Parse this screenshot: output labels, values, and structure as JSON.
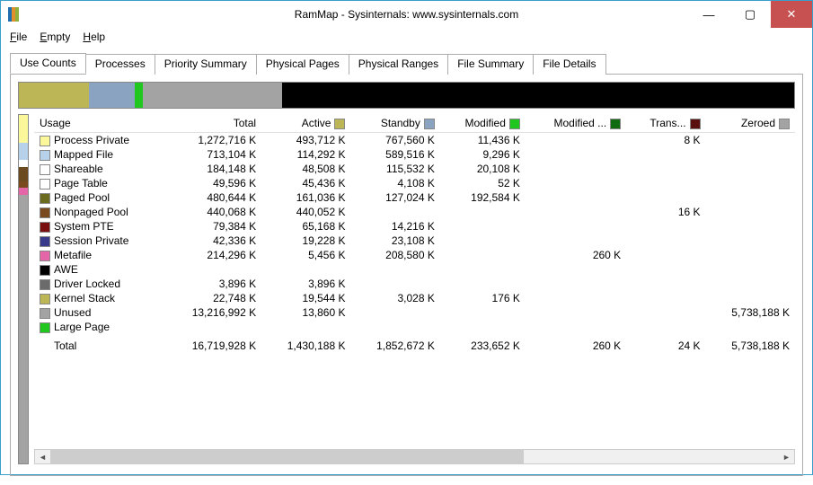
{
  "window": {
    "title": "RamMap - Sysinternals: www.sysinternals.com",
    "icon_colors": [
      "#1f6fb0",
      "#e08f2c",
      "#8fb03a"
    ]
  },
  "menubar": [
    {
      "label": "File",
      "u": "F"
    },
    {
      "label": "Empty",
      "u": "E"
    },
    {
      "label": "Help",
      "u": "H"
    }
  ],
  "tabs": [
    "Use Counts",
    "Processes",
    "Priority Summary",
    "Physical Pages",
    "Physical Ranges",
    "File Summary",
    "File Details"
  ],
  "active_tab": 0,
  "stackbar": [
    {
      "color": "#bcb656",
      "pct": 9.0
    },
    {
      "color": "#8aa3c1",
      "pct": 6.0
    },
    {
      "color": "#1fc71f",
      "pct": 1.0
    },
    {
      "color": "#a3a3a3",
      "pct": 18.0
    },
    {
      "color": "#000000",
      "pct": 66.0
    }
  ],
  "leftlegend": [
    {
      "color": "#fbf89b",
      "pct": 8
    },
    {
      "color": "#b8d1ea",
      "pct": 5
    },
    {
      "color": "#ffffff",
      "pct": 2
    },
    {
      "color": "#6b4a1f",
      "pct": 4
    },
    {
      "color": "#7a4a1f",
      "pct": 2
    },
    {
      "color": "#e566a8",
      "pct": 2
    },
    {
      "color": "#a3a3a3",
      "pct": 77
    }
  ],
  "columns": [
    {
      "label": "Usage",
      "align": "l"
    },
    {
      "label": "Total",
      "align": "r"
    },
    {
      "label": "Active",
      "align": "r",
      "swatch": "#bcb656"
    },
    {
      "label": "Standby",
      "align": "r",
      "swatch": "#8aa3c1"
    },
    {
      "label": "Modified",
      "align": "r",
      "swatch": "#1fc71f"
    },
    {
      "label": "Modified ...",
      "align": "r",
      "swatch": "#0f6b0f"
    },
    {
      "label": "Trans...",
      "align": "r",
      "swatch": "#5a0f0f"
    },
    {
      "label": "Zeroed",
      "align": "r",
      "swatch": "#a3a3a3"
    }
  ],
  "rows": [
    {
      "swatch": "#fbf89b",
      "usage": "Process Private",
      "total": "1,272,716 K",
      "active": "493,712 K",
      "standby": "767,560 K",
      "modified": "11,436 K",
      "modifiedp": "",
      "trans": "8 K",
      "zeroed": ""
    },
    {
      "swatch": "#b8d1ea",
      "usage": "Mapped File",
      "total": "713,104 K",
      "active": "114,292 K",
      "standby": "589,516 K",
      "modified": "9,296 K",
      "modifiedp": "",
      "trans": "",
      "zeroed": ""
    },
    {
      "swatch": "#ffffff",
      "usage": "Shareable",
      "total": "184,148 K",
      "active": "48,508 K",
      "standby": "115,532 K",
      "modified": "20,108 K",
      "modifiedp": "",
      "trans": "",
      "zeroed": ""
    },
    {
      "swatch": "#ffffff",
      "usage": "Page Table",
      "total": "49,596 K",
      "active": "45,436 K",
      "standby": "4,108 K",
      "modified": "52 K",
      "modifiedp": "",
      "trans": "",
      "zeroed": ""
    },
    {
      "swatch": "#6b6b1f",
      "usage": "Paged Pool",
      "total": "480,644 K",
      "active": "161,036 K",
      "standby": "127,024 K",
      "modified": "192,584 K",
      "modifiedp": "",
      "trans": "",
      "zeroed": ""
    },
    {
      "swatch": "#7a4a1f",
      "usage": "Nonpaged Pool",
      "total": "440,068 K",
      "active": "440,052 K",
      "standby": "",
      "modified": "",
      "modifiedp": "",
      "trans": "16 K",
      "zeroed": ""
    },
    {
      "swatch": "#7a0f0f",
      "usage": "System PTE",
      "total": "79,384 K",
      "active": "65,168 K",
      "standby": "14,216 K",
      "modified": "",
      "modifiedp": "",
      "trans": "",
      "zeroed": ""
    },
    {
      "swatch": "#3a3a8a",
      "usage": "Session Private",
      "total": "42,336 K",
      "active": "19,228 K",
      "standby": "23,108 K",
      "modified": "",
      "modifiedp": "",
      "trans": "",
      "zeroed": ""
    },
    {
      "swatch": "#e566a8",
      "usage": "Metafile",
      "total": "214,296 K",
      "active": "5,456 K",
      "standby": "208,580 K",
      "modified": "",
      "modifiedp": "260 K",
      "trans": "",
      "zeroed": ""
    },
    {
      "swatch": "#000000",
      "usage": "AWE",
      "total": "",
      "active": "",
      "standby": "",
      "modified": "",
      "modifiedp": "",
      "trans": "",
      "zeroed": ""
    },
    {
      "swatch": "#6b6b6b",
      "usage": "Driver Locked",
      "total": "3,896 K",
      "active": "3,896 K",
      "standby": "",
      "modified": "",
      "modifiedp": "",
      "trans": "",
      "zeroed": ""
    },
    {
      "swatch": "#bcb656",
      "usage": "Kernel Stack",
      "total": "22,748 K",
      "active": "19,544 K",
      "standby": "3,028 K",
      "modified": "176 K",
      "modifiedp": "",
      "trans": "",
      "zeroed": ""
    },
    {
      "swatch": "#a3a3a3",
      "usage": "Unused",
      "total": "13,216,992 K",
      "active": "13,860 K",
      "standby": "",
      "modified": "",
      "modifiedp": "",
      "trans": "",
      "zeroed": "5,738,188 K"
    },
    {
      "swatch": "#1fc71f",
      "usage": "Large Page",
      "total": "",
      "active": "",
      "standby": "",
      "modified": "",
      "modifiedp": "",
      "trans": "",
      "zeroed": ""
    }
  ],
  "totals": {
    "usage": "Total",
    "total": "16,719,928 K",
    "active": "1,430,188 K",
    "standby": "1,852,672 K",
    "modified": "233,652 K",
    "modifiedp": "260 K",
    "trans": "24 K",
    "zeroed": "5,738,188 K"
  },
  "chart_data": {
    "type": "bar",
    "title": "RamMap Use Counts",
    "categories": [
      "Process Private",
      "Mapped File",
      "Shareable",
      "Page Table",
      "Paged Pool",
      "Nonpaged Pool",
      "System PTE",
      "Session Private",
      "Metafile",
      "AWE",
      "Driver Locked",
      "Kernel Stack",
      "Unused",
      "Large Page"
    ],
    "series": [
      {
        "name": "Active",
        "values": [
          493712,
          114292,
          48508,
          45436,
          161036,
          440052,
          65168,
          19228,
          5456,
          0,
          3896,
          19544,
          13860,
          0
        ]
      },
      {
        "name": "Standby",
        "values": [
          767560,
          589516,
          115532,
          4108,
          127024,
          0,
          14216,
          23108,
          208580,
          0,
          0,
          3028,
          0,
          0
        ]
      },
      {
        "name": "Modified",
        "values": [
          11436,
          9296,
          20108,
          52,
          192584,
          0,
          0,
          0,
          0,
          0,
          0,
          176,
          0,
          0
        ]
      },
      {
        "name": "Modified No-Write",
        "values": [
          0,
          0,
          0,
          0,
          0,
          0,
          0,
          0,
          260,
          0,
          0,
          0,
          0,
          0
        ]
      },
      {
        "name": "Transition",
        "values": [
          8,
          0,
          0,
          0,
          0,
          16,
          0,
          0,
          0,
          0,
          0,
          0,
          0,
          0
        ]
      },
      {
        "name": "Zeroed",
        "values": [
          0,
          0,
          0,
          0,
          0,
          0,
          0,
          0,
          0,
          0,
          0,
          0,
          5738188,
          0
        ]
      }
    ],
    "unit": "K",
    "total_memory_k": 16719928
  }
}
